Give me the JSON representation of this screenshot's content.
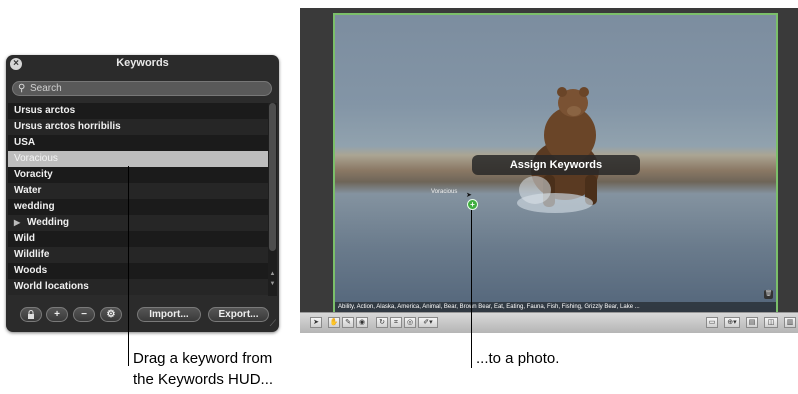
{
  "hud": {
    "title": "Keywords",
    "close_glyph": "×",
    "search_placeholder": "Search",
    "keywords": [
      {
        "label": "Ursus arctos"
      },
      {
        "label": "Ursus arctos horribilis"
      },
      {
        "label": "USA"
      },
      {
        "label": "Voracious",
        "selected": true
      },
      {
        "label": "Voracity"
      },
      {
        "label": "Water"
      },
      {
        "label": "wedding"
      },
      {
        "label": "Wedding",
        "has_children": true
      },
      {
        "label": "Wild"
      },
      {
        "label": "Wildlife"
      },
      {
        "label": "Woods"
      },
      {
        "label": "World locations"
      }
    ],
    "toolbar": {
      "lock_icon": "lock-icon",
      "add_glyph": "+",
      "remove_glyph": "−",
      "settings_glyph": "⚙",
      "import_label": "Import...",
      "export_label": "Export..."
    }
  },
  "viewer": {
    "assign_label": "Assign Keywords",
    "drag_ghost_text": "Voracious",
    "keyword_strip": "Ability, Action, Alaska, America, Animal, Bear, Brown Bear, Eat, Eating, Fauna, Fish, Fishing, Grizzly Bear, Lake ...",
    "selection_color": "#7bbf6a"
  },
  "callouts": {
    "left_line1": "Drag a keyword from",
    "left_line2": "the Keywords HUD...",
    "right": "...to a photo."
  }
}
